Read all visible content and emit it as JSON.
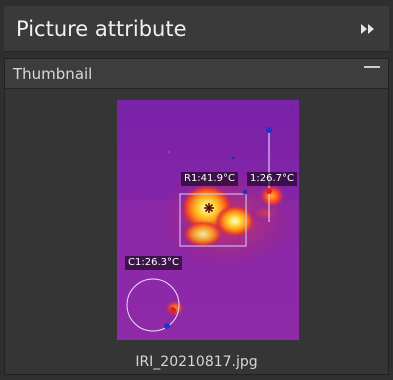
{
  "panel": {
    "title": "Picture attribute",
    "expand_icon": "double-chevron-right-icon"
  },
  "thumbnail_section": {
    "title": "Thumbnail",
    "collapse_icon": "minus-icon",
    "image": {
      "kind": "thermal-image",
      "palette": "ironbow",
      "filename": "IRI_20210817.jpg",
      "annotations": {
        "rect_label": "R1:41.9°C",
        "line_label": "1:26.7°C",
        "circle_label": "C1:26.3°C"
      }
    }
  },
  "colors": {
    "panel_bg": "#2f2f2f",
    "header_bg": "#3a3a3a",
    "section_bg": "#353535",
    "text": "#f0f0f0"
  }
}
